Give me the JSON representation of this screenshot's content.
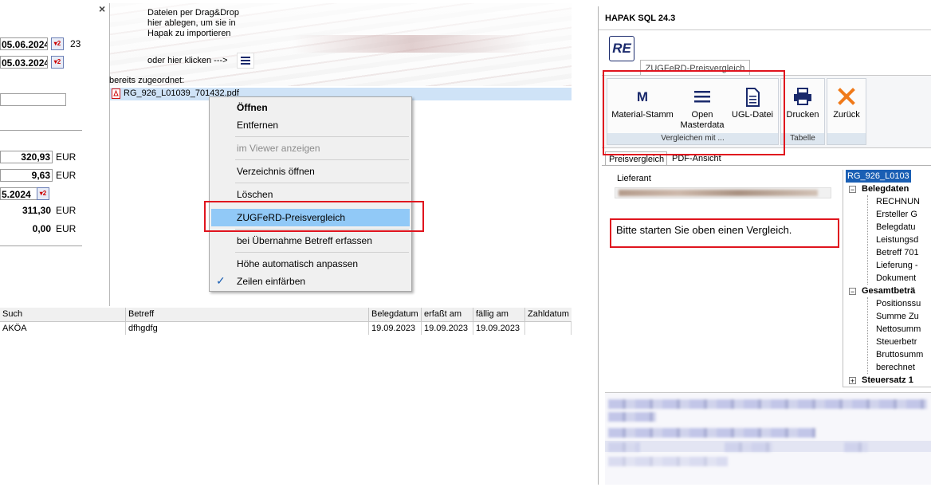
{
  "left": {
    "close_glyph": "×",
    "date1": "05.06.2024",
    "date1_suffix": "23",
    "date2": "05.03.2024",
    "date3": "5.2024",
    "amount1": "320,93",
    "amount2": "9,63",
    "amount3": "311,30",
    "amount4": "0,00",
    "currency": "EUR",
    "drop_hint_line1": "Dateien per Drag&Drop",
    "drop_hint_line2": "hier ablegen, um sie in",
    "drop_hint_line3": "Hapak zu importieren",
    "click_hint": "oder hier klicken --->",
    "assigned_label": "bereits zugeordnet:",
    "assigned_file": "RG_926_L01039_701432.pdf",
    "grid": {
      "columns": [
        "Such",
        "Betreff",
        "Belegdatum",
        "erfaßt am",
        "fällig am",
        "Zahldatum"
      ],
      "rows": [
        {
          "such": "AKÖA",
          "betreff": "dfhgdfg",
          "belegdatum": "19.09.2023",
          "erfasst": "19.09.2023",
          "faellig": "19.09.2023",
          "zahldatum": ""
        }
      ]
    }
  },
  "context_menu": {
    "items": [
      {
        "label": "Öffnen",
        "bold": true
      },
      {
        "label": "Entfernen"
      },
      {
        "label": "im Viewer anzeigen",
        "disabled": true
      },
      {
        "label": "Verzeichnis öffnen"
      },
      {
        "label": "Löschen"
      },
      {
        "label": "ZUGFeRD-Preisvergleich",
        "highlighted": true
      },
      {
        "label": "bei Übernahme Betreff erfassen"
      },
      {
        "label": "Höhe automatisch anpassen"
      },
      {
        "label": "Zeilen einfärben",
        "checked": true
      }
    ],
    "check_glyph": "✓"
  },
  "window": {
    "title": "HAPAK SQL 24.3",
    "logo_text": "RE",
    "ribbon_tab": "ZUGFeRD-Preisvergleich",
    "buttons": {
      "material_stamm": "Material-Stamm",
      "open_masterdata_1": "Open",
      "open_masterdata_2": "Masterdata",
      "ugl_datei": "UGL-Datei",
      "drucken": "Drucken",
      "zurueck": "Zurück"
    },
    "group_vergleichen": "Vergleichen mit ...",
    "group_tabelle": "Tabelle",
    "tabs": [
      "Preisvergleich",
      "PDF-Ansicht"
    ],
    "lieferant_label": "Lieferant",
    "message": "Bitte starten Sie oben einen Vergleich.",
    "tree": {
      "root": "RG_926_L0103",
      "belegdaten": "Belegdaten",
      "belegdaten_children": [
        "RECHNUN",
        "Ersteller G",
        "Belegdatu",
        "Leistungsd",
        "Betreff 701",
        "Lieferung -",
        "Dokument"
      ],
      "gesamtbetrag": "Gesamtbeträ",
      "gesamt_children": [
        "Positionssu",
        "Summe Zu",
        "Nettosumm",
        "Steuerbetr",
        "Bruttosumm",
        "berechnet"
      ],
      "steuersatz": "Steuersatz 1"
    }
  },
  "colors": {
    "highlight": "#91c9f7",
    "red_frame": "#e0141e",
    "orange_x": "#f07a1a",
    "navy": "#1a2a6c"
  }
}
